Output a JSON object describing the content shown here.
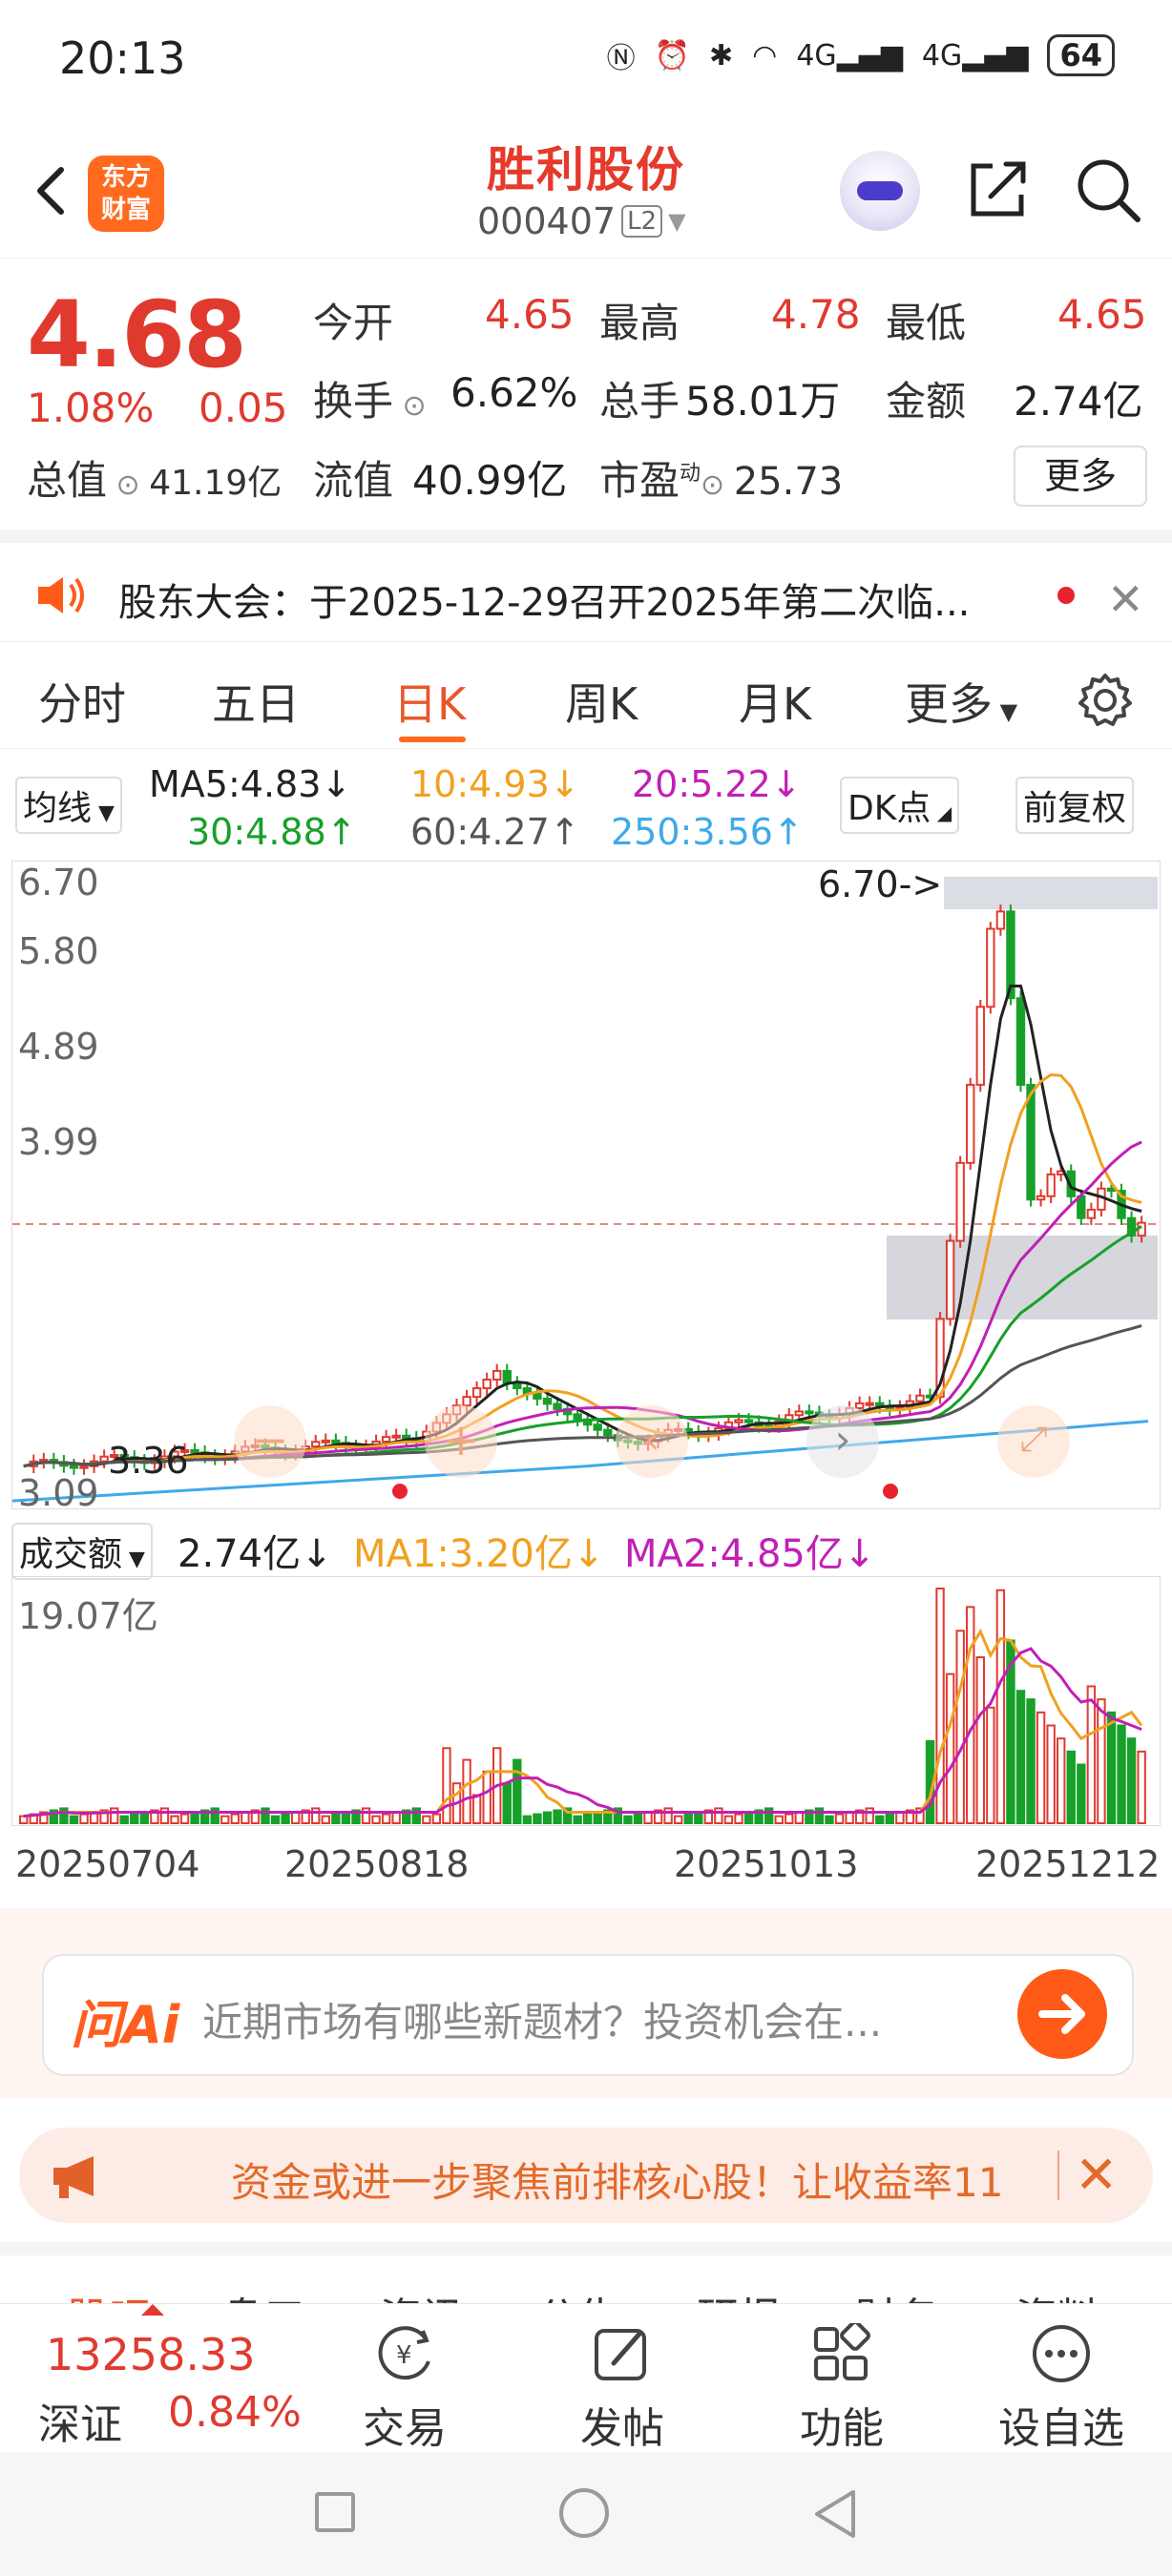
{
  "status_bar": {
    "time": "20:13",
    "network1": "4G",
    "network2": "4G",
    "battery": "64"
  },
  "header": {
    "logo_text_1": "东方",
    "logo_text_2": "财富",
    "stock_name": "胜利股份",
    "stock_code": "000407",
    "level_badge": "L2"
  },
  "quote": {
    "price": "4.68",
    "change_pct": "1.08%",
    "change_amt": "0.05",
    "fields": {
      "open_label": "今开",
      "open": "4.65",
      "high_label": "最高",
      "high": "4.78",
      "low_label": "最低",
      "low": "4.65",
      "turnover_label": "换手",
      "turnover": "6.62%",
      "volume_label": "总手",
      "volume": "58.01万",
      "amount_label": "金额",
      "amount": "2.74亿",
      "mktcap_label": "总值",
      "mktcap": "41.19亿",
      "float_label": "流值",
      "float_cap": "40.99亿",
      "pe_label": "市盈",
      "pe_sup": "动",
      "pe": "25.73"
    },
    "more_label": "更多"
  },
  "notice": {
    "text": "股东大会：于2025-12-29召开2025年第二次临..."
  },
  "tabs": [
    "分时",
    "五日",
    "日K",
    "周K",
    "月K",
    "更多"
  ],
  "active_tab": "日K",
  "ma_legend": {
    "selector": "均线",
    "ma5": "MA5:4.83↓",
    "ma10": "10:4.93↓",
    "ma20": "20:5.22↓",
    "ma30": "30:4.88↑",
    "ma60": "60:4.27↑",
    "ma250": "250:3.56↑",
    "dk_label": "DK点",
    "adjust_label": "前复权"
  },
  "kline": {
    "y_labels": [
      "6.70",
      "5.80",
      "4.89",
      "3.99",
      "3.09"
    ],
    "max_marker": "6.70->",
    "min_marker": "3.36"
  },
  "volume": {
    "selector": "成交额",
    "value": "2.74亿↓",
    "ma1": "MA1:3.20亿↓",
    "ma2": "MA2:4.85亿↓",
    "y_label": "19.07亿",
    "dates": [
      "20250704",
      "20250818",
      "20251013",
      "20251212"
    ]
  },
  "colors": {
    "up": "#e03a2f",
    "down": "#17a02a",
    "ma5": "#222222",
    "ma10": "#f2a020",
    "ma20": "#c21fb6",
    "ma30": "#17a02a",
    "ma60": "#555555",
    "ma250": "#3fa9e8",
    "brand": "#ff6a1f"
  },
  "ai_bar": {
    "logo": "问Ai",
    "placeholder": "近期市场有哪些新题材？投资机会在..."
  },
  "promo": {
    "text": "资金或进一步聚焦前排核心股！让收益率11"
  },
  "sub_tabs": [
    "股吧",
    "盘口",
    "资讯",
    "公告",
    "研报",
    "财务",
    "资料"
  ],
  "bottom_nav": {
    "index_value": "13258.33",
    "index_name": "深证",
    "index_change": "0.84%",
    "items": [
      "交易",
      "发帖",
      "功能",
      "设自选"
    ]
  }
}
